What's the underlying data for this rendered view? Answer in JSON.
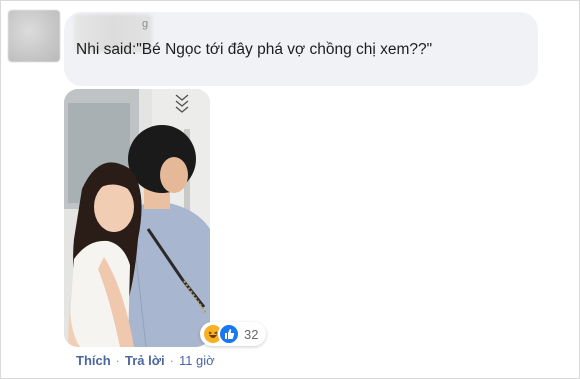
{
  "comment": {
    "author_visible_part": "Nhi",
    "text": "Nhi said:\"Bé Ngọc tới đây phá vợ chồng chị xem??\"",
    "name_tail": "g"
  },
  "reactions": {
    "count": "32",
    "icons": [
      "haha-icon",
      "like-icon"
    ]
  },
  "actions": {
    "like_label": "Thích",
    "reply_label": "Trả lời",
    "time_label": "11 giờ",
    "separator": "·"
  },
  "colors": {
    "bubble": "#f0f2f5",
    "link": "#4b67a1",
    "like_blue": "#1877f2",
    "haha_yellow": "#f7b125"
  }
}
